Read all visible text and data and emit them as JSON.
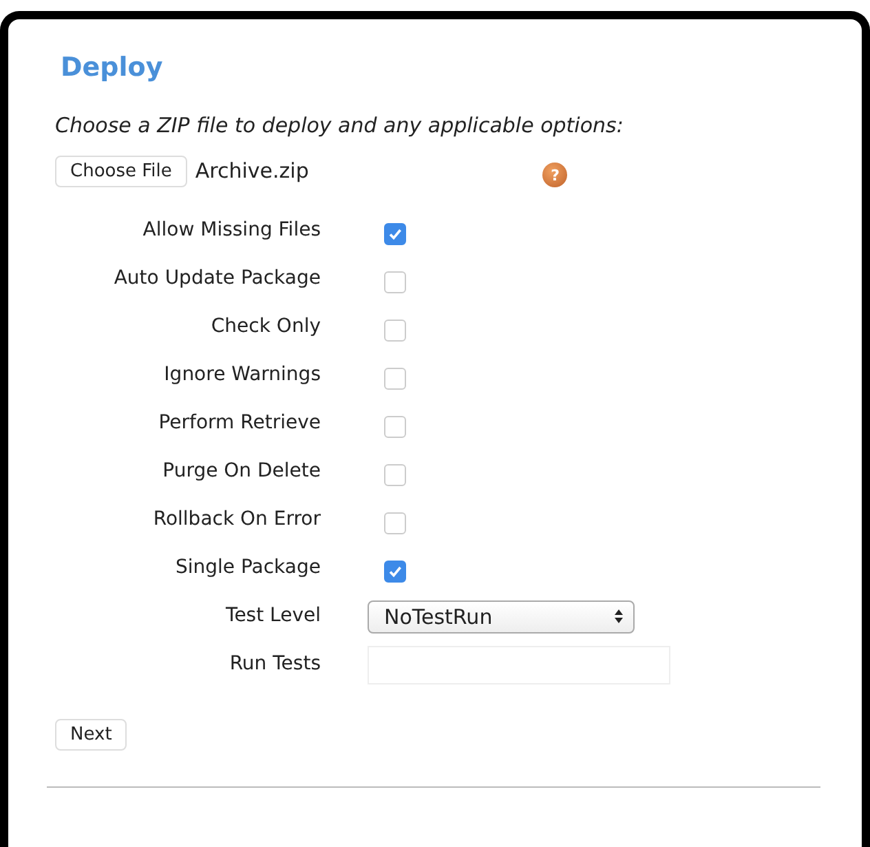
{
  "title": "Deploy",
  "instructions": "Choose a ZIP file to deploy and any applicable options:",
  "file_picker": {
    "button": "Choose File",
    "file_name": "Archive.zip",
    "help_icon": "?"
  },
  "options": [
    {
      "label": "Allow Missing Files",
      "checked": true
    },
    {
      "label": "Auto Update Package",
      "checked": false
    },
    {
      "label": "Check Only",
      "checked": false
    },
    {
      "label": "Ignore Warnings",
      "checked": false
    },
    {
      "label": "Perform Retrieve",
      "checked": false
    },
    {
      "label": "Purge On Delete",
      "checked": false
    },
    {
      "label": "Rollback On Error",
      "checked": false
    },
    {
      "label": "Single Package",
      "checked": true
    }
  ],
  "test_level": {
    "label": "Test Level",
    "value": "NoTestRun"
  },
  "run_tests": {
    "label": "Run Tests"
  },
  "buttons": [
    "Next"
  ]
}
